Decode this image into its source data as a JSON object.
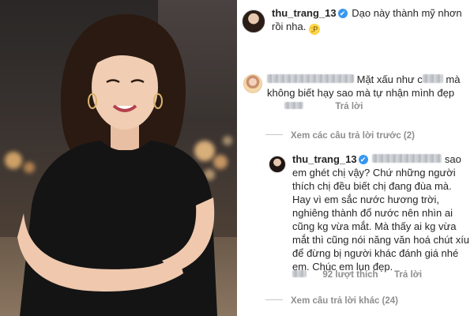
{
  "post_caption": {
    "username": "thu_trang_13",
    "verified_mark": "✔",
    "text": "Dạo này thành mỹ nhơn rồi nha.",
    "emoji": "😜"
  },
  "comment_1": {
    "text_part1": "Mặt xấu như c",
    "text_part2": "mà không biết hạy sao mà tự nhận mình đẹp",
    "reply_label": "Trả lời"
  },
  "view_previous": "Xem các câu trả lời trước (2)",
  "reply_comment": {
    "username": "thu_trang_13",
    "verified_mark": "✔",
    "text": "sao em ghét chị vậy? Chứ những người thích chị đều biết chị đang đùa mà. Hay vì em sắc nước hương trời, nghiêng thành đổ nước nên nhìn ai cũng kg vừa mắt. Mà thấy ai kg vừa mắt thì cũng nói năng văn hoá chút xíu để đừng bị người khác đánh giá nhé em. Chúc em lun đẹp.",
    "likes_label": "92 lượt thích",
    "reply_label": "Trả lời"
  },
  "view_more": "Xem câu trả lời khác (24)",
  "colors": {
    "text": "#262626",
    "meta": "#8e8e8e",
    "verified": "#3897f0"
  }
}
